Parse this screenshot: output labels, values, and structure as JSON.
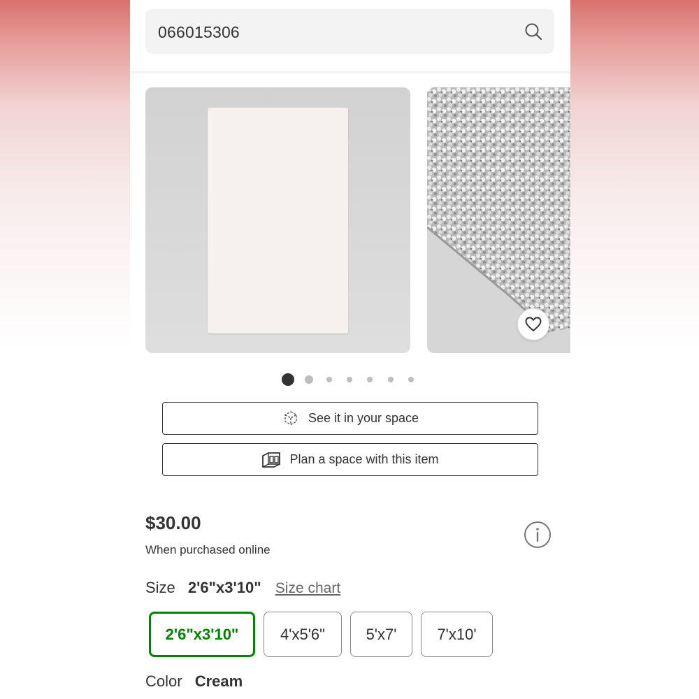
{
  "search": {
    "value": "066015306"
  },
  "product": {
    "price": "$30.00",
    "price_note": "When purchased online",
    "size_label": "Size",
    "size_selected": "2'6\"x3'10\"",
    "size_chart_link": "Size chart",
    "size_options": [
      "2'6\"x3'10\"",
      "4'x5'6\"",
      "5'x7'",
      "7'x10'"
    ],
    "color_label": "Color",
    "color_selected": "Cream"
  },
  "actions": {
    "see_in_space": "See it in your space",
    "plan_space": "Plan a space with this item"
  },
  "carousel": {
    "total_images": 7,
    "active_index": 0
  },
  "icons": {
    "search": "search-icon",
    "heart": "heart-icon",
    "ar_cube": "ar-cube-icon",
    "room_plan": "room-plan-icon",
    "info": "info-icon"
  },
  "colors": {
    "selected_accent": "#008300",
    "text": "#333333",
    "outline": "#333333"
  }
}
